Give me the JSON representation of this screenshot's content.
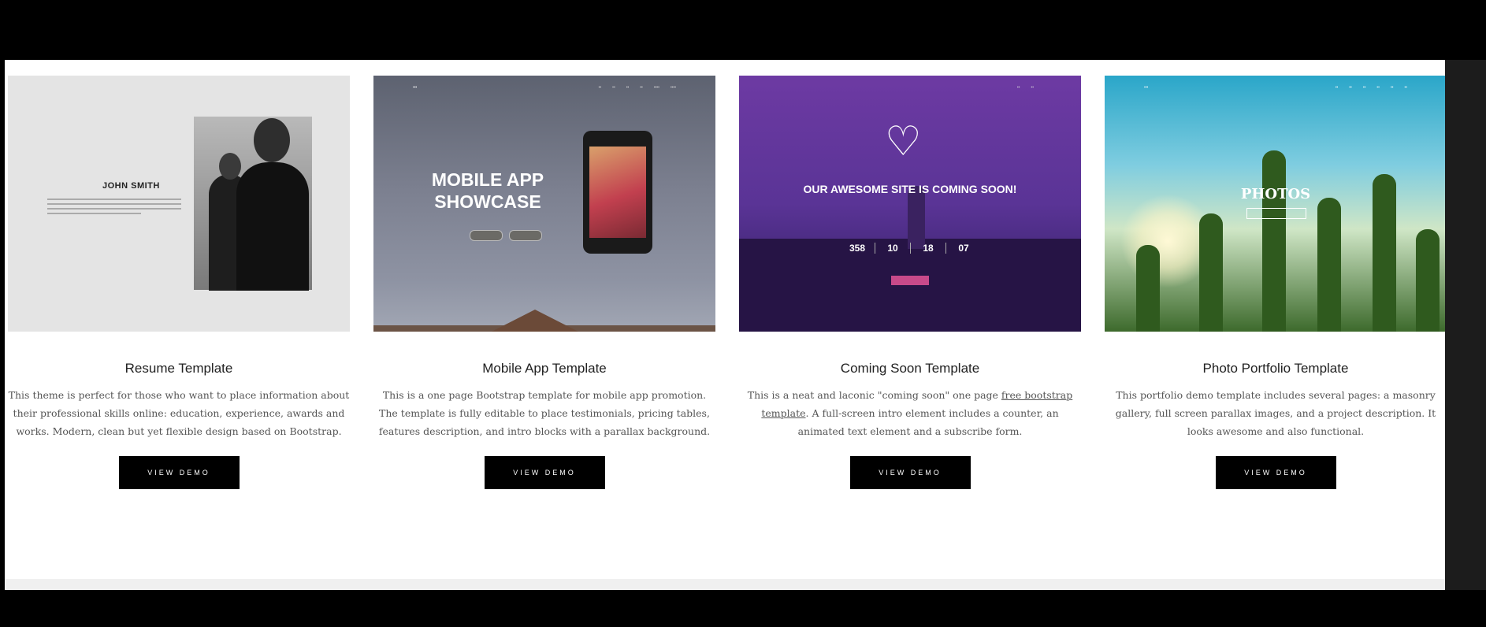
{
  "cards": [
    {
      "title": "Resume Template",
      "description": "This theme is perfect for those who want to place information about their professional skills online: education, experience, awards and works. Modern, clean but yet flexible design based on Bootstrap.",
      "button": "VIEW DEMO",
      "thumb": {
        "name": "JOHN SMITH"
      }
    },
    {
      "title": "Mobile App Template",
      "description": "This is a one page Bootstrap template for mobile app promotion. The template is fully editable to place testimonials, pricing tables, features description, and intro blocks with a parallax background.",
      "button": "VIEW DEMO",
      "thumb": {
        "heading": "MOBILE APP SHOWCASE"
      }
    },
    {
      "title": "Coming Soon Template",
      "description_before": "This is a neat and laconic \"coming soon\" one page ",
      "description_link": "free bootstrap template",
      "description_after": ". A full-screen intro element includes a counter, an animated text element and a subscribe form.",
      "button": "VIEW DEMO",
      "thumb": {
        "heading": "OUR AWESOME SITE IS COMING SOON!",
        "counter": [
          "358",
          "10",
          "18",
          "07"
        ]
      }
    },
    {
      "title": "Photo Portfolio Template",
      "description": "This portfolio demo template includes several pages: a masonry gallery, full screen parallax images, and a project description. It looks awesome and also functional.",
      "button": "VIEW DEMO",
      "thumb": {
        "heading": "PHOTOS"
      }
    }
  ]
}
